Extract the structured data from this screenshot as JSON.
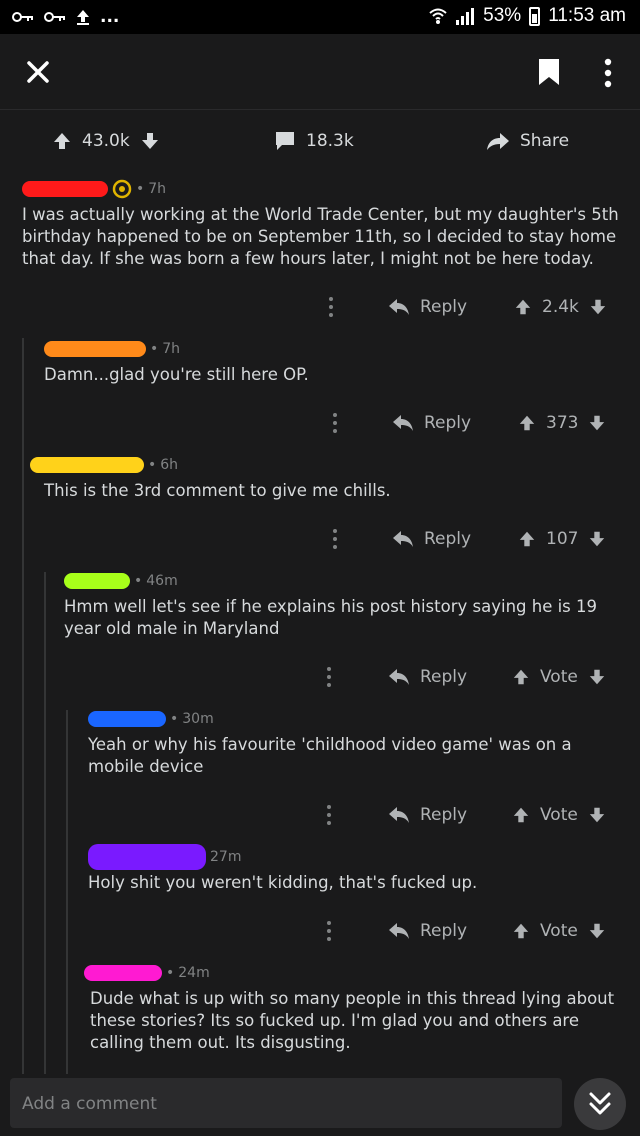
{
  "status": {
    "battery": "53%",
    "time": "11:53 am"
  },
  "post": {
    "upvotes": "43.0k",
    "comments": "18.3k",
    "share_label": "Share"
  },
  "actions": {
    "reply_label": "Reply"
  },
  "comments": [
    {
      "author_color": "#ff1a1a",
      "age": "7h",
      "text": "I was actually working at the World Trade Center, but my daughter's 5th birthday happened to be on September 11th, so I decided to stay home that day. If she was born a few hours later, I might not be here today.",
      "score": "2.4k"
    },
    {
      "author_color": "#ff8a1a",
      "age": "7h",
      "text": "Damn...glad you're still here OP.",
      "score": "373"
    },
    {
      "author_color": "#ffd21a",
      "age": "6h",
      "text": "This is the 3rd comment to give me chills.",
      "score": "107"
    },
    {
      "author_color": "#a8ff1a",
      "age": "46m",
      "text": "Hmm well let's see if he explains his post history saying he is 19 year old male in Maryland",
      "score": "Vote"
    },
    {
      "author_color": "#1a66ff",
      "age": "30m",
      "text": "Yeah or why his favourite 'childhood video game' was on a mobile device",
      "score": "Vote"
    },
    {
      "author_color": "#7a1aff",
      "age": "27m",
      "text": "Holy shit you weren't kidding, that's fucked up.",
      "score": "Vote"
    },
    {
      "author_color": "#ff1ad2",
      "age": "24m",
      "text": "Dude what is up with so many people in this thread lying about these stories? Its so fucked up. I'm glad you and others are calling them out. Its disgusting."
    }
  ],
  "composer": {
    "placeholder": "Add a comment"
  },
  "icons": {
    "close": "close-icon",
    "bookmark": "bookmark-icon",
    "more": "more-vertical-icon",
    "upvote": "arrow-up-icon",
    "downvote": "arrow-down-icon",
    "comment": "comment-bubble-icon",
    "share": "share-arrow-icon",
    "reply": "reply-arrow-icon",
    "jump": "double-chevron-down-icon"
  }
}
